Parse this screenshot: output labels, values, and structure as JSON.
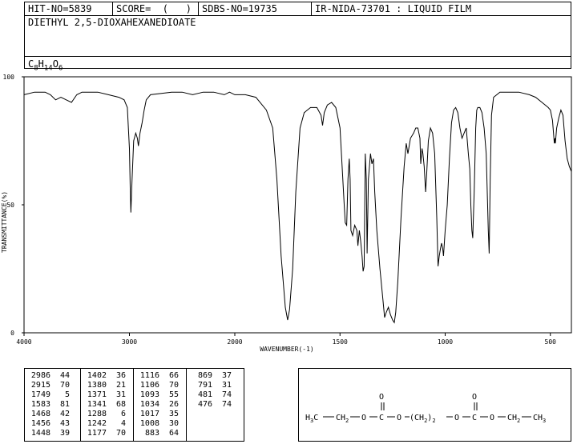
{
  "header": {
    "hit_no": "HIT-NO=5839",
    "score": "SCORE=  (   )",
    "sdbs_no": "SDBS-NO=19735",
    "ir_code": "IR-NIDA-73701 : LIQUID FILM",
    "compound_name": "DIETHYL 2,5-DIOXAHEXANEDIOATE",
    "formula": {
      "c": "C",
      "c_n": "8",
      "h": "H",
      "h_n": "14",
      "o": "O",
      "o_n": "6"
    }
  },
  "chart_data": {
    "type": "line",
    "title": "",
    "xlabel": "WAVENUMBER(-1)",
    "ylabel": "TRANSMITTANCE(%)",
    "xlim": [
      4000,
      400
    ],
    "ylim": [
      0,
      100
    ],
    "x_ticks": [
      4000,
      3000,
      2000,
      1500,
      1000,
      500
    ],
    "y_ticks": [
      0,
      50,
      100
    ],
    "grid": false,
    "series": [
      {
        "name": "",
        "points": [
          [
            4000,
            93
          ],
          [
            3900,
            94
          ],
          [
            3800,
            94
          ],
          [
            3750,
            93
          ],
          [
            3700,
            91
          ],
          [
            3650,
            92
          ],
          [
            3600,
            91
          ],
          [
            3550,
            90
          ],
          [
            3500,
            93
          ],
          [
            3450,
            94
          ],
          [
            3300,
            94
          ],
          [
            3200,
            93
          ],
          [
            3100,
            92
          ],
          [
            3050,
            91
          ],
          [
            3020,
            88
          ],
          [
            3000,
            72
          ],
          [
            2992,
            55
          ],
          [
            2986,
            47
          ],
          [
            2975,
            60
          ],
          [
            2960,
            75
          ],
          [
            2940,
            78
          ],
          [
            2925,
            76
          ],
          [
            2915,
            73
          ],
          [
            2900,
            78
          ],
          [
            2880,
            82
          ],
          [
            2860,
            87
          ],
          [
            2840,
            91
          ],
          [
            2800,
            93
          ],
          [
            2600,
            94
          ],
          [
            2500,
            94
          ],
          [
            2400,
            93
          ],
          [
            2300,
            94
          ],
          [
            2200,
            94
          ],
          [
            2100,
            93
          ],
          [
            2050,
            94
          ],
          [
            2000,
            93
          ],
          [
            1950,
            93
          ],
          [
            1900,
            92
          ],
          [
            1850,
            87
          ],
          [
            1820,
            80
          ],
          [
            1800,
            60
          ],
          [
            1780,
            30
          ],
          [
            1760,
            10
          ],
          [
            1749,
            5
          ],
          [
            1740,
            9
          ],
          [
            1725,
            25
          ],
          [
            1710,
            55
          ],
          [
            1690,
            80
          ],
          [
            1670,
            86
          ],
          [
            1640,
            88
          ],
          [
            1610,
            88
          ],
          [
            1590,
            85
          ],
          [
            1583,
            81
          ],
          [
            1575,
            86
          ],
          [
            1560,
            89
          ],
          [
            1540,
            90
          ],
          [
            1520,
            88
          ],
          [
            1500,
            80
          ],
          [
            1490,
            65
          ],
          [
            1480,
            50
          ],
          [
            1475,
            43
          ],
          [
            1468,
            42
          ],
          [
            1462,
            60
          ],
          [
            1456,
            68
          ],
          [
            1452,
            60
          ],
          [
            1448,
            40
          ],
          [
            1440,
            38
          ],
          [
            1430,
            42
          ],
          [
            1420,
            40
          ],
          [
            1415,
            34
          ],
          [
            1408,
            40
          ],
          [
            1402,
            36
          ],
          [
            1395,
            30
          ],
          [
            1390,
            24
          ],
          [
            1385,
            26
          ],
          [
            1380,
            70
          ],
          [
            1375,
            60
          ],
          [
            1371,
            31
          ],
          [
            1365,
            60
          ],
          [
            1355,
            70
          ],
          [
            1348,
            66
          ],
          [
            1341,
            68
          ],
          [
            1335,
            55
          ],
          [
            1325,
            40
          ],
          [
            1310,
            25
          ],
          [
            1295,
            12
          ],
          [
            1288,
            6
          ],
          [
            1280,
            8
          ],
          [
            1270,
            10
          ],
          [
            1260,
            7
          ],
          [
            1250,
            5
          ],
          [
            1242,
            4
          ],
          [
            1235,
            8
          ],
          [
            1225,
            20
          ],
          [
            1210,
            45
          ],
          [
            1195,
            65
          ],
          [
            1185,
            74
          ],
          [
            1177,
            70
          ],
          [
            1165,
            76
          ],
          [
            1150,
            78
          ],
          [
            1140,
            80
          ],
          [
            1130,
            80
          ],
          [
            1120,
            76
          ],
          [
            1116,
            66
          ],
          [
            1110,
            72
          ],
          [
            1106,
            70
          ],
          [
            1100,
            65
          ],
          [
            1093,
            55
          ],
          [
            1088,
            62
          ],
          [
            1080,
            75
          ],
          [
            1070,
            80
          ],
          [
            1060,
            78
          ],
          [
            1050,
            70
          ],
          [
            1040,
            45
          ],
          [
            1034,
            26
          ],
          [
            1028,
            30
          ],
          [
            1022,
            33
          ],
          [
            1017,
            35
          ],
          [
            1012,
            33
          ],
          [
            1008,
            30
          ],
          [
            1000,
            40
          ],
          [
            990,
            50
          ],
          [
            980,
            68
          ],
          [
            970,
            82
          ],
          [
            960,
            87
          ],
          [
            950,
            88
          ],
          [
            940,
            86
          ],
          [
            930,
            80
          ],
          [
            920,
            76
          ],
          [
            910,
            78
          ],
          [
            900,
            80
          ],
          [
            890,
            70
          ],
          [
            883,
            64
          ],
          [
            878,
            50
          ],
          [
            873,
            40
          ],
          [
            869,
            37
          ],
          [
            862,
            55
          ],
          [
            855,
            80
          ],
          [
            850,
            87
          ],
          [
            845,
            88
          ],
          [
            835,
            88
          ],
          [
            825,
            86
          ],
          [
            815,
            80
          ],
          [
            805,
            70
          ],
          [
            795,
            40
          ],
          [
            791,
            31
          ],
          [
            786,
            60
          ],
          [
            780,
            85
          ],
          [
            770,
            92
          ],
          [
            740,
            94
          ],
          [
            700,
            94
          ],
          [
            650,
            94
          ],
          [
            600,
            93
          ],
          [
            570,
            92
          ],
          [
            540,
            90
          ],
          [
            510,
            88
          ],
          [
            500,
            87
          ],
          [
            490,
            83
          ],
          [
            481,
            74
          ],
          [
            478,
            76
          ],
          [
            476,
            74
          ],
          [
            470,
            80
          ],
          [
            460,
            84
          ],
          [
            450,
            87
          ],
          [
            440,
            85
          ],
          [
            430,
            75
          ],
          [
            420,
            68
          ],
          [
            410,
            65
          ],
          [
            400,
            63
          ]
        ]
      }
    ]
  },
  "peaks": [
    [
      [
        "2986",
        "44"
      ],
      [
        "2915",
        "70"
      ],
      [
        "1749",
        "5"
      ],
      [
        "1583",
        "81"
      ],
      [
        "1468",
        "42"
      ],
      [
        "1456",
        "43"
      ],
      [
        "1448",
        "39"
      ]
    ],
    [
      [
        "1402",
        "36"
      ],
      [
        "1380",
        "21"
      ],
      [
        "1371",
        "31"
      ],
      [
        "1341",
        "68"
      ],
      [
        "1288",
        "6"
      ],
      [
        "1242",
        "4"
      ],
      [
        "1177",
        "70"
      ]
    ],
    [
      [
        "1116",
        "66"
      ],
      [
        "1106",
        "70"
      ],
      [
        "1093",
        "55"
      ],
      [
        "1034",
        "26"
      ],
      [
        "1017",
        "35"
      ],
      [
        "1008",
        "30"
      ],
      [
        "883",
        "64"
      ]
    ],
    [
      [
        "869",
        "37"
      ],
      [
        "791",
        "31"
      ],
      [
        "481",
        "74"
      ],
      [
        "476",
        "74"
      ]
    ]
  ],
  "structure": {
    "h3c": "H",
    "h3c_sub": "3",
    "c": "C",
    "ch2": "CH",
    "ch2_sub": "2",
    "o": "O",
    "c_carbonyl": "C",
    "o_dbl": "O",
    "open_paren": "(",
    "close_paren": ")",
    "chain_sub": "2",
    "ch3": "CH",
    "ch3_sub": "3"
  }
}
